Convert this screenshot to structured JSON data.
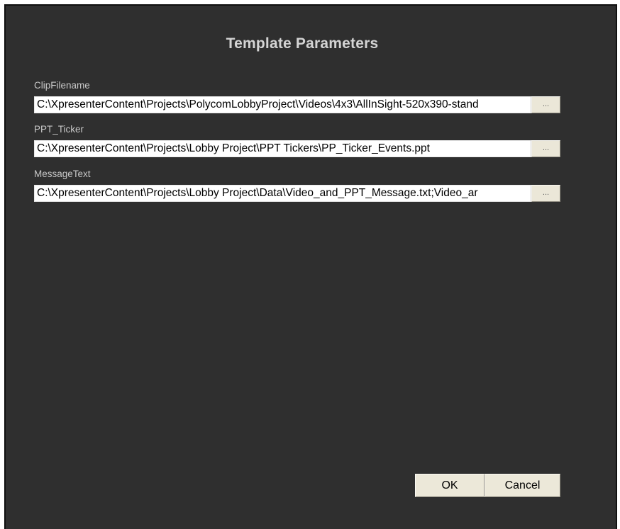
{
  "dialog": {
    "title": "Template Parameters"
  },
  "params": [
    {
      "label": "ClipFilename",
      "value": "C:\\XpresenterContent\\Projects\\PolycomLobbyProject\\Videos\\4x3\\AllInSight-520x390-stand",
      "browse_label": "..."
    },
    {
      "label": "PPT_Ticker",
      "value": "C:\\XpresenterContent\\Projects\\Lobby Project\\PPT Tickers\\PP_Ticker_Events.ppt",
      "browse_label": "..."
    },
    {
      "label": "MessageText",
      "value": "C:\\XpresenterContent\\Projects\\Lobby Project\\Data\\Video_and_PPT_Message.txt;Video_ar",
      "browse_label": "..."
    }
  ],
  "buttons": {
    "ok": "OK",
    "cancel": "Cancel"
  }
}
